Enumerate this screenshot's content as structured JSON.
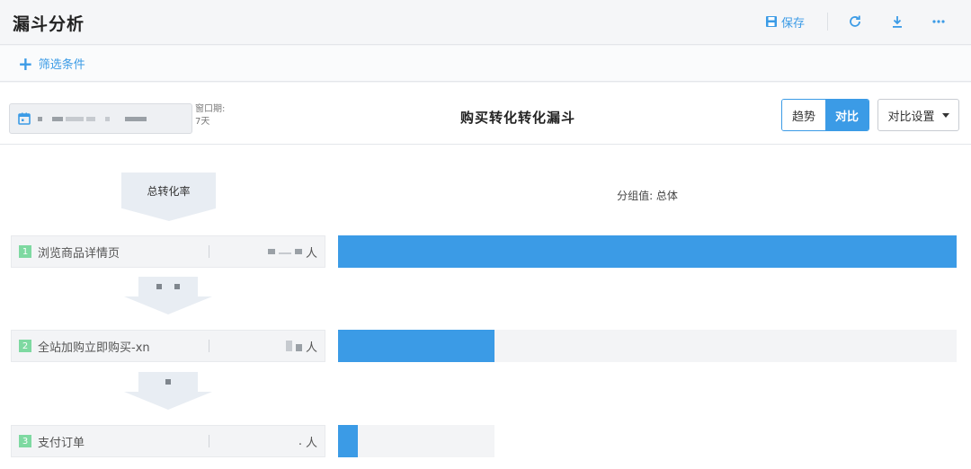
{
  "header": {
    "title": "漏斗分析",
    "save_label": "保存",
    "refresh_icon": "refresh-icon",
    "download_icon": "download-icon",
    "more_icon": "more-icon"
  },
  "filter": {
    "add_label": "筛选条件"
  },
  "toolbar": {
    "window_label": "窗口期:",
    "window_value": "7天",
    "chart_title": "购买转化转化漏斗",
    "toggle_trend": "趋势",
    "toggle_compare": "对比",
    "active_toggle": "对比",
    "settings_label": "对比设置"
  },
  "funnel": {
    "total_label": "总转化率",
    "group_label": "分组值: 总体",
    "steps": [
      {
        "num": "1",
        "name": "浏览商品详情页",
        "unit": "人",
        "bar_fraction": 1.0
      },
      {
        "num": "2",
        "name": "全站加购立即购买-xn",
        "unit": "人",
        "bar_fraction": 0.253
      },
      {
        "num": "3",
        "name": "支付订单",
        "unit": "人",
        "prefix": ".",
        "bar_fraction": 0.032
      }
    ]
  },
  "colors": {
    "accent": "#3b9be6",
    "step_badge": "#7ed9a1",
    "track": "#f3f4f6"
  }
}
